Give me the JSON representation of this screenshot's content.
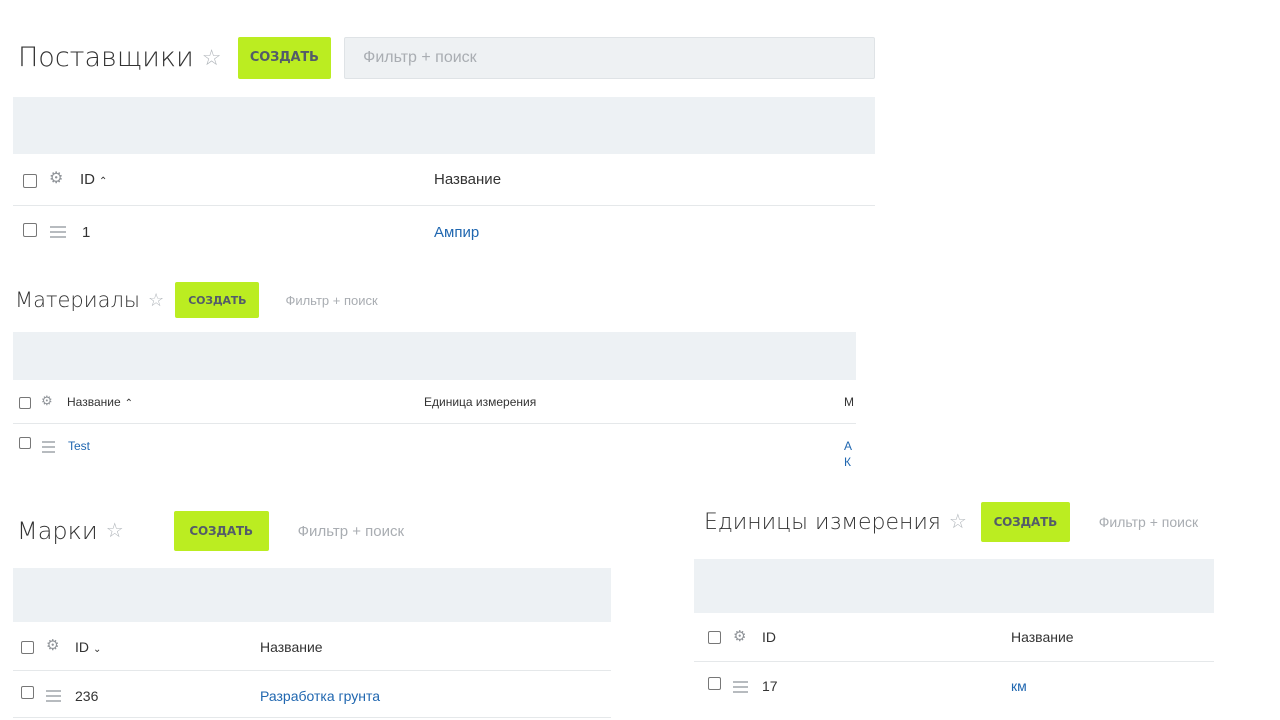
{
  "suppliers": {
    "title": "Поставщики",
    "create_label": "СОЗДАТЬ",
    "search_placeholder": "Фильтр + поиск",
    "columns": {
      "id": "ID",
      "name": "Название"
    },
    "sort_arrow": "⌃",
    "rows": [
      {
        "id": "1",
        "name": "Ампир"
      }
    ]
  },
  "materials": {
    "title": "Материалы",
    "create_label": "СОЗДАТЬ",
    "search_placeholder": "Фильтр + поиск",
    "columns": {
      "name": "Название",
      "unit": "Единица измерения",
      "third": "М"
    },
    "sort_arrow": "⌃",
    "rows": [
      {
        "name": "Test",
        "third_line1": "А",
        "third_line2": "К"
      }
    ]
  },
  "brands": {
    "title": "Марки",
    "create_label": "СОЗДАТЬ",
    "search_placeholder": "Фильтр + поиск",
    "columns": {
      "id": "ID",
      "name": "Название"
    },
    "sort_arrow": "⌄",
    "rows": [
      {
        "id": "236",
        "name": "Разработка грунта"
      }
    ]
  },
  "units": {
    "title": "Единицы измерения",
    "create_label": "СОЗДАТЬ",
    "search_placeholder": "Фильтр + поиск",
    "columns": {
      "id": "ID",
      "name": "Название"
    },
    "rows": [
      {
        "id": "17",
        "name": "км"
      }
    ]
  },
  "icons": {
    "star": "star-outline-icon",
    "gear": "gear-icon",
    "drag": "row-menu-icon"
  },
  "colors": {
    "create_button": "#bbed21",
    "link": "#2067b0",
    "toolbar_bg": "#edf1f4"
  }
}
